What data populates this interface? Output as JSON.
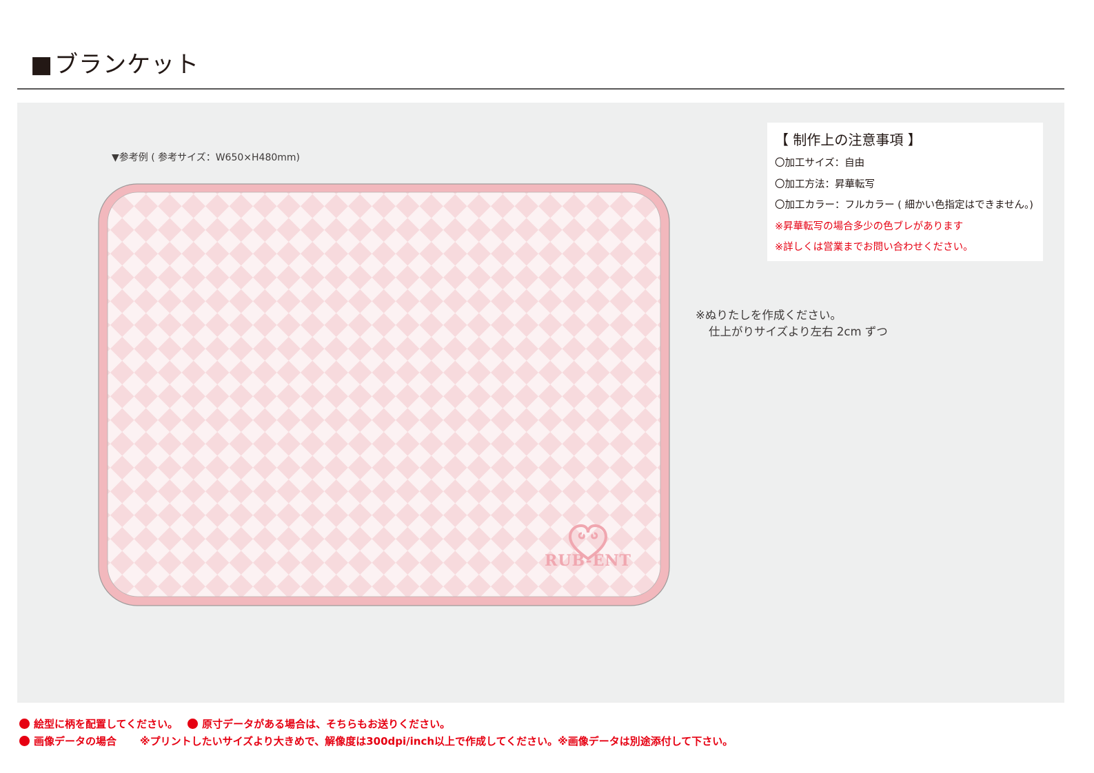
{
  "header": {
    "title_marker": "■",
    "title": "ブランケット"
  },
  "reference": {
    "label": "▼参考例 ( 参考サイズ：W650×H480mm)"
  },
  "blanket": {
    "logo_text": "RUB-ENT",
    "logo_icon": "heart-icon",
    "border_color": "#f2b8bd",
    "pattern_color_light": "#fcf2f3",
    "pattern_color_dark": "#f7dadd"
  },
  "notes": {
    "title": "【 制作上の注意事項 】",
    "items": [
      "〇加工サイズ：自由",
      "〇加工方法：昇華転写",
      "〇加工カラー：フルカラー ( 細かい色指定はできません。)"
    ],
    "warnings": [
      "※昇華転写の場合多少の色ブレがあります",
      "※詳しくは営業までお問い合わせください。"
    ],
    "warning_color": "#e60012"
  },
  "bleed": {
    "line1": "※ぬりたしを作成ください。",
    "line2": "仕上がりサイズより左右 2cm ずつ"
  },
  "footer": {
    "item1": "絵型に柄を配置してください。",
    "item2": "原寸データがある場合は、そちらもお送りください。",
    "item3_label": "画像データの場合",
    "item3_text": "※プリントしたいサイズより大きめで、解像度は300dpi/inch以上で作成してください。※画像データは別途添付して下さい。"
  }
}
